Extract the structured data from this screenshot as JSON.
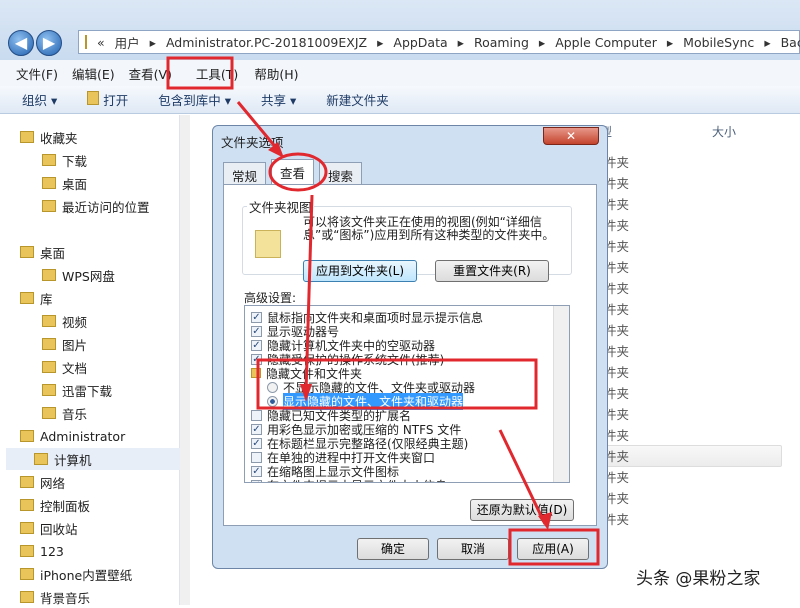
{
  "nav": {
    "back": "◀",
    "forward": "▶"
  },
  "address": {
    "prefix": "«",
    "segments": [
      "用户",
      "Administrator.PC-20181009EXJZ",
      "AppData",
      "Roaming",
      "Apple Computer",
      "MobileSync",
      "Backup"
    ]
  },
  "menu": [
    "文件(F)",
    "编辑(E)",
    "查看(V)",
    "工具(T)",
    "帮助(H)"
  ],
  "toolbar": [
    "组织 ▾",
    "打开",
    "包含到库中 ▾",
    "共享 ▾",
    "新建文件夹"
  ],
  "sidebar": [
    "收藏夹",
    "下载",
    "桌面",
    "最近访问的位置",
    "桌面",
    "WPS网盘",
    "库",
    "视频",
    "图片",
    "文档",
    "迅雷下载",
    "音乐",
    "Administrator",
    "计算机",
    "网络",
    "控制面板",
    "回收站",
    "123",
    "iPhone内置壁纸",
    "背景音乐"
  ],
  "columns": {
    "type": "型",
    "size": "大小"
  },
  "rows": [
    "件夹",
    "件夹",
    "件夹",
    "件夹",
    "件夹",
    "件夹",
    "件夹",
    "件夹",
    "件夹",
    "件夹",
    "件夹",
    "件夹",
    "件夹",
    "件夹",
    "件夹",
    "件夹",
    "件夹",
    "件夹"
  ],
  "dialog": {
    "title": "文件夹选项",
    "close": "✕",
    "tabs": [
      "常规",
      "查看",
      "搜索"
    ],
    "folder_views": {
      "legend": "文件夹视图",
      "desc": "可以将该文件夹正在使用的视图(例如“详细信息”或“图标”)应用到所有这种类型的文件夹中。",
      "apply": "应用到文件夹(L)",
      "reset": "重置文件夹(R)"
    },
    "advanced_label": "高级设置:",
    "items": [
      {
        "type": "check",
        "checked": true,
        "label": "鼠标指向文件夹和桌面项时显示提示信息"
      },
      {
        "type": "check",
        "checked": true,
        "label": "显示驱动器号"
      },
      {
        "type": "check",
        "checked": true,
        "label": "隐藏计算机文件夹中的空驱动器"
      },
      {
        "type": "check",
        "checked": true,
        "label": "隐藏受保护的操作系统文件(推荐)"
      },
      {
        "type": "folder",
        "label": "隐藏文件和文件夹"
      },
      {
        "type": "radio",
        "checked": false,
        "label": "不显示隐藏的文件、文件夹或驱动器"
      },
      {
        "type": "radio",
        "checked": true,
        "label": "显示隐藏的文件、文件夹和驱动器"
      },
      {
        "type": "check",
        "checked": false,
        "label": "隐藏已知文件类型的扩展名"
      },
      {
        "type": "check",
        "checked": true,
        "label": "用彩色显示加密或压缩的 NTFS 文件"
      },
      {
        "type": "check",
        "checked": true,
        "label": "在标题栏显示完整路径(仅限经典主题)"
      },
      {
        "type": "check",
        "checked": false,
        "label": "在单独的进程中打开文件夹窗口"
      },
      {
        "type": "check",
        "checked": true,
        "label": "在缩略图上显示文件图标"
      },
      {
        "type": "check",
        "checked": true,
        "label": "在文件夹提示中显示文件大小信息"
      }
    ],
    "restore": "还原为默认值(D)",
    "ok": "确定",
    "cancel": "取消",
    "apply": "应用(A)"
  },
  "watermark": "头条 @果粉之家",
  "colors": {
    "annotation": "#e0282e",
    "selection": "#3399ff"
  }
}
